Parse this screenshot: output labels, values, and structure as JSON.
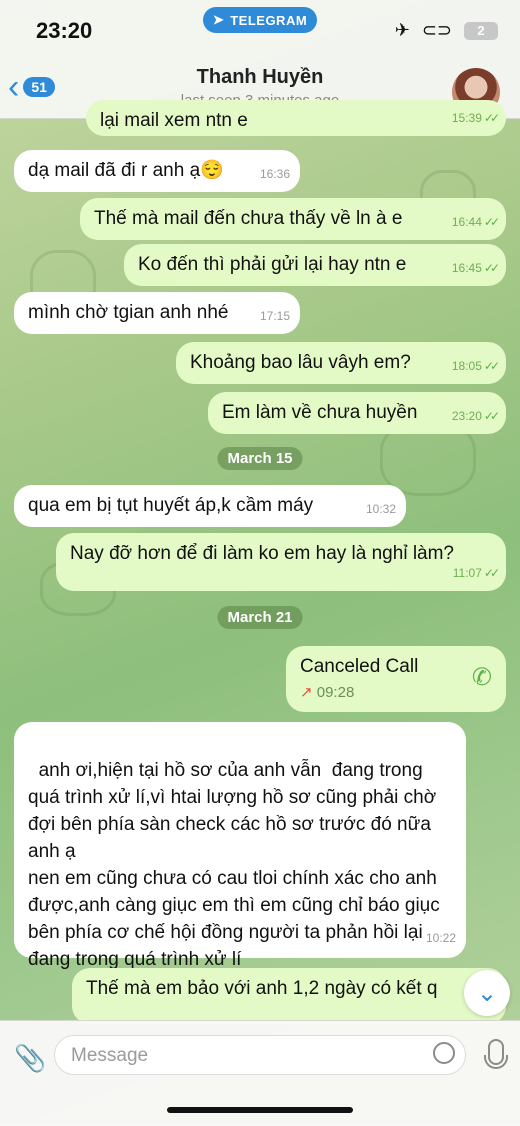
{
  "status_bar": {
    "time": "23:20",
    "app_pill": "TELEGRAM",
    "battery": "2"
  },
  "header": {
    "back_count": "51",
    "name": "Thanh Huyền",
    "last_seen": "last seen 3 minutes ago"
  },
  "messages": [
    {
      "dir": "out",
      "text": "lại mail xem ntn e",
      "time": "15:39"
    },
    {
      "dir": "in",
      "text": "dạ mail đã đi r anh ạ😌",
      "time": "16:36"
    },
    {
      "dir": "out",
      "text": "Thế mà mail đến chưa thấy về ln à e",
      "time": "16:44"
    },
    {
      "dir": "out",
      "text": "Ko đến thì phải gửi lại hay ntn e",
      "time": "16:45"
    },
    {
      "dir": "in",
      "text": "mình chờ tgian anh nhé",
      "time": "17:15"
    },
    {
      "dir": "out",
      "text": "Khoảng bao lâu vâyh em?",
      "time": "18:05"
    },
    {
      "dir": "out",
      "text": "Em làm về chưa huyền",
      "time": "23:20"
    },
    {
      "dir": "in",
      "text": "qua em bị tụt huyết áp,k cầm máy",
      "time": "10:32"
    },
    {
      "dir": "out",
      "text": "Nay đỡ hơn để đi làm ko em hay là nghỉ làm?",
      "time": "11:07"
    },
    {
      "dir": "in",
      "text": "anh ơi,hiện tại hồ sơ của anh vẫn  đang trong quá trình xử lí,vì htai lượng hồ sơ cũng phải chờ đợi bên phía sàn check các hồ sơ trước đó nữa anh ạ\nnen em cũng chưa có cau tloi chính xác cho anh được,anh càng giục em thì em cũng chỉ báo giục  bên phía cơ chế hội đồng người ta phản hồi lại đang trong quá trình xử lí",
      "time": "10:22"
    },
    {
      "dir": "out",
      "text": "Thế mà em bảo với anh 1,2 ngày có kết q",
      "time": "11:2"
    }
  ],
  "dates": [
    "March 15",
    "March 21"
  ],
  "call": {
    "title": "Canceled Call",
    "time": "09:28"
  },
  "input": {
    "placeholder": "Message"
  },
  "colors": {
    "accent": "#2f8bd8",
    "out_bubble": "#e3fac6",
    "in_bubble": "#ffffff"
  }
}
